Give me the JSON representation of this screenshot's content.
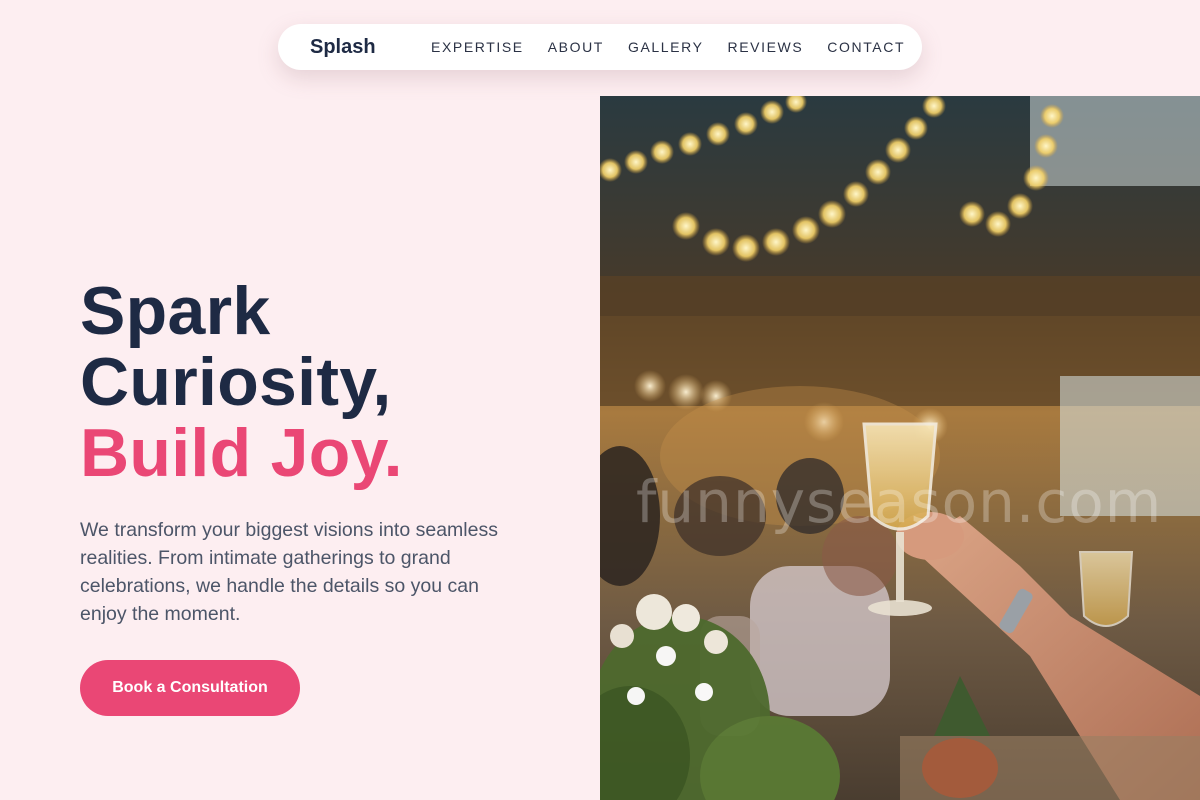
{
  "nav": {
    "brand": "Splash",
    "links": [
      "EXPERTISE",
      "ABOUT",
      "GALLERY",
      "REVIEWS",
      "CONTACT"
    ]
  },
  "hero": {
    "title_line1": "Spark",
    "title_line2": "Curiosity,",
    "title_accent": "Build Joy.",
    "body": "We transform your biggest visions into seamless realities. From intimate gatherings to grand celebrations, we handle the details so you can enjoy the moment.",
    "cta_label": "Book a Consultation"
  },
  "photo": {
    "subject": "celebration-toast-photo",
    "watermark": "funnyseason.com"
  },
  "colors": {
    "background": "#fdeef1",
    "navy": "#1e2a44",
    "accent": "#ea4775",
    "body_text": "#4c5568"
  }
}
